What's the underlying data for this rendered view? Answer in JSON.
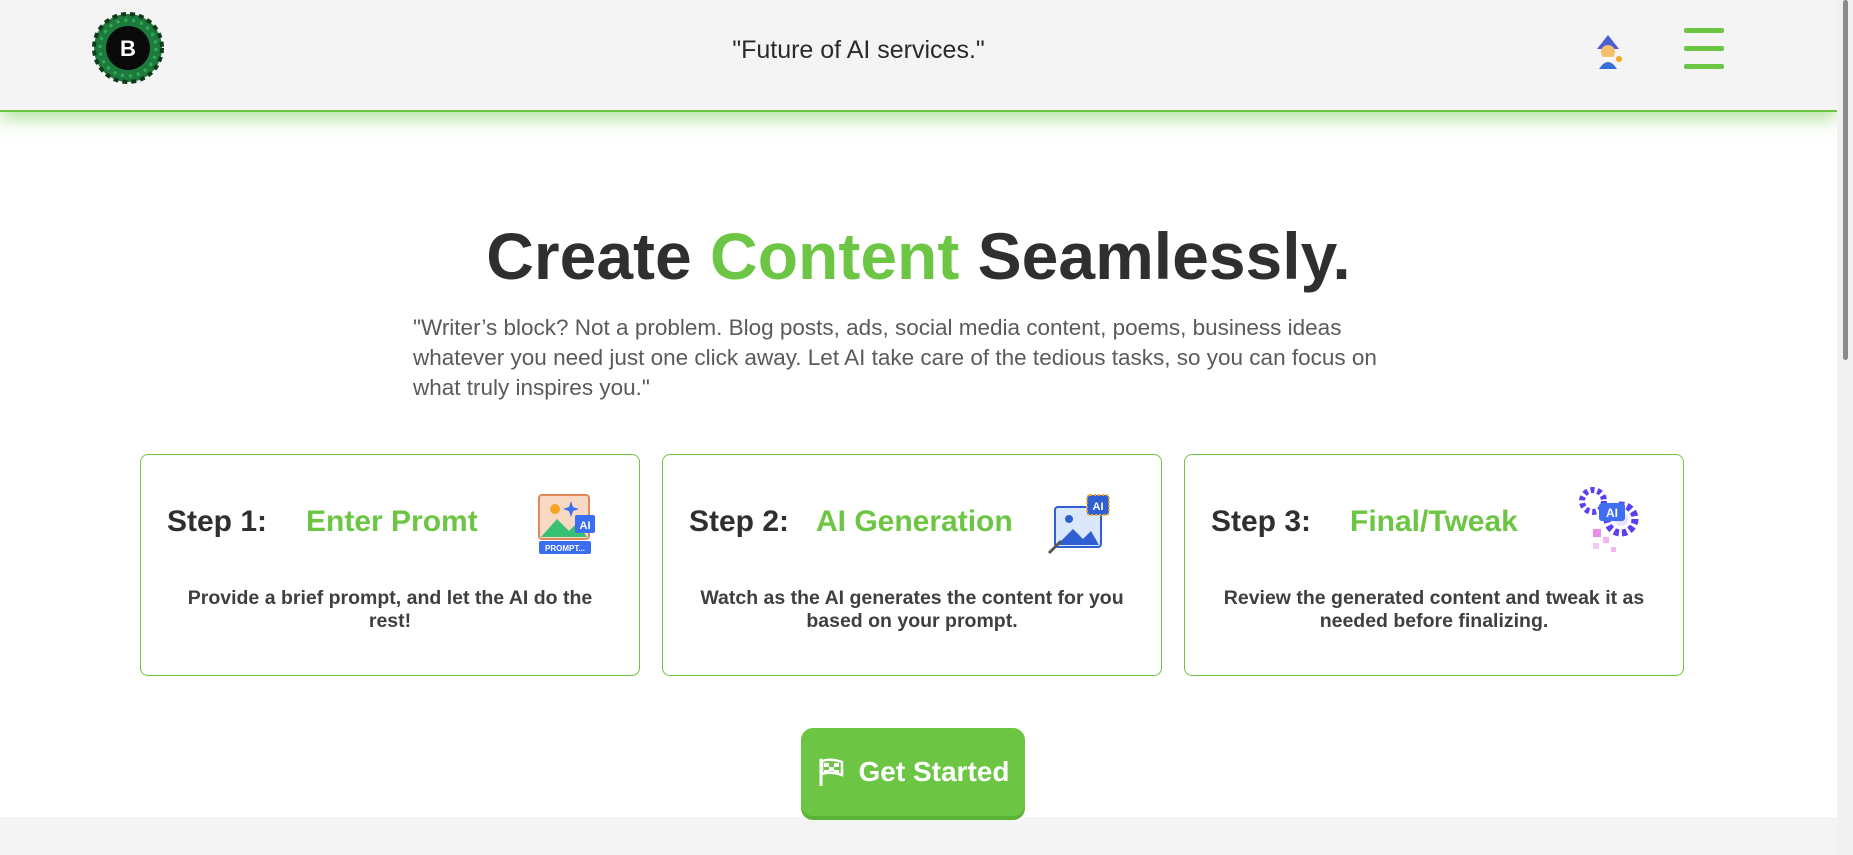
{
  "header": {
    "logo_letter": "B",
    "tagline": "\"Future of AI services.\"",
    "avatar_icon": "wizard-avatar-icon",
    "menu_icon": "hamburger-menu-icon"
  },
  "hero": {
    "title_before": "Create ",
    "title_accent": "Content",
    "title_after": " Seamlessly.",
    "description": "\"Writer’s block? Not a problem. Blog posts, ads, social media content, poems, business ideas whatever you need just one click away. Let AI take care of the tedious tasks, so you can focus on what truly inspires you.\""
  },
  "steps": [
    {
      "number_label": "Step 1:",
      "name": "Enter Promt",
      "icon": "prompt-image-icon",
      "icon_badge": "AI",
      "icon_tag": "PROMPT...",
      "description": "Provide a brief prompt, and let the AI do the rest!"
    },
    {
      "number_label": "Step 2:",
      "name": "AI Generation",
      "icon": "ai-image-generation-icon",
      "icon_badge": "AI",
      "description": "Watch as the AI generates the content for you based on your prompt."
    },
    {
      "number_label": "Step 3:",
      "name": "Final/Tweak",
      "icon": "ai-gears-icon",
      "icon_badge": "AI",
      "description": "Review the generated content and tweak it as needed before finalizing."
    }
  ],
  "cta": {
    "label": "Get Started",
    "icon": "checkered-flag-icon"
  },
  "colors": {
    "accent": "#6cc644",
    "text_dark": "#2f2f2f",
    "header_bg": "#f4f4f4"
  }
}
